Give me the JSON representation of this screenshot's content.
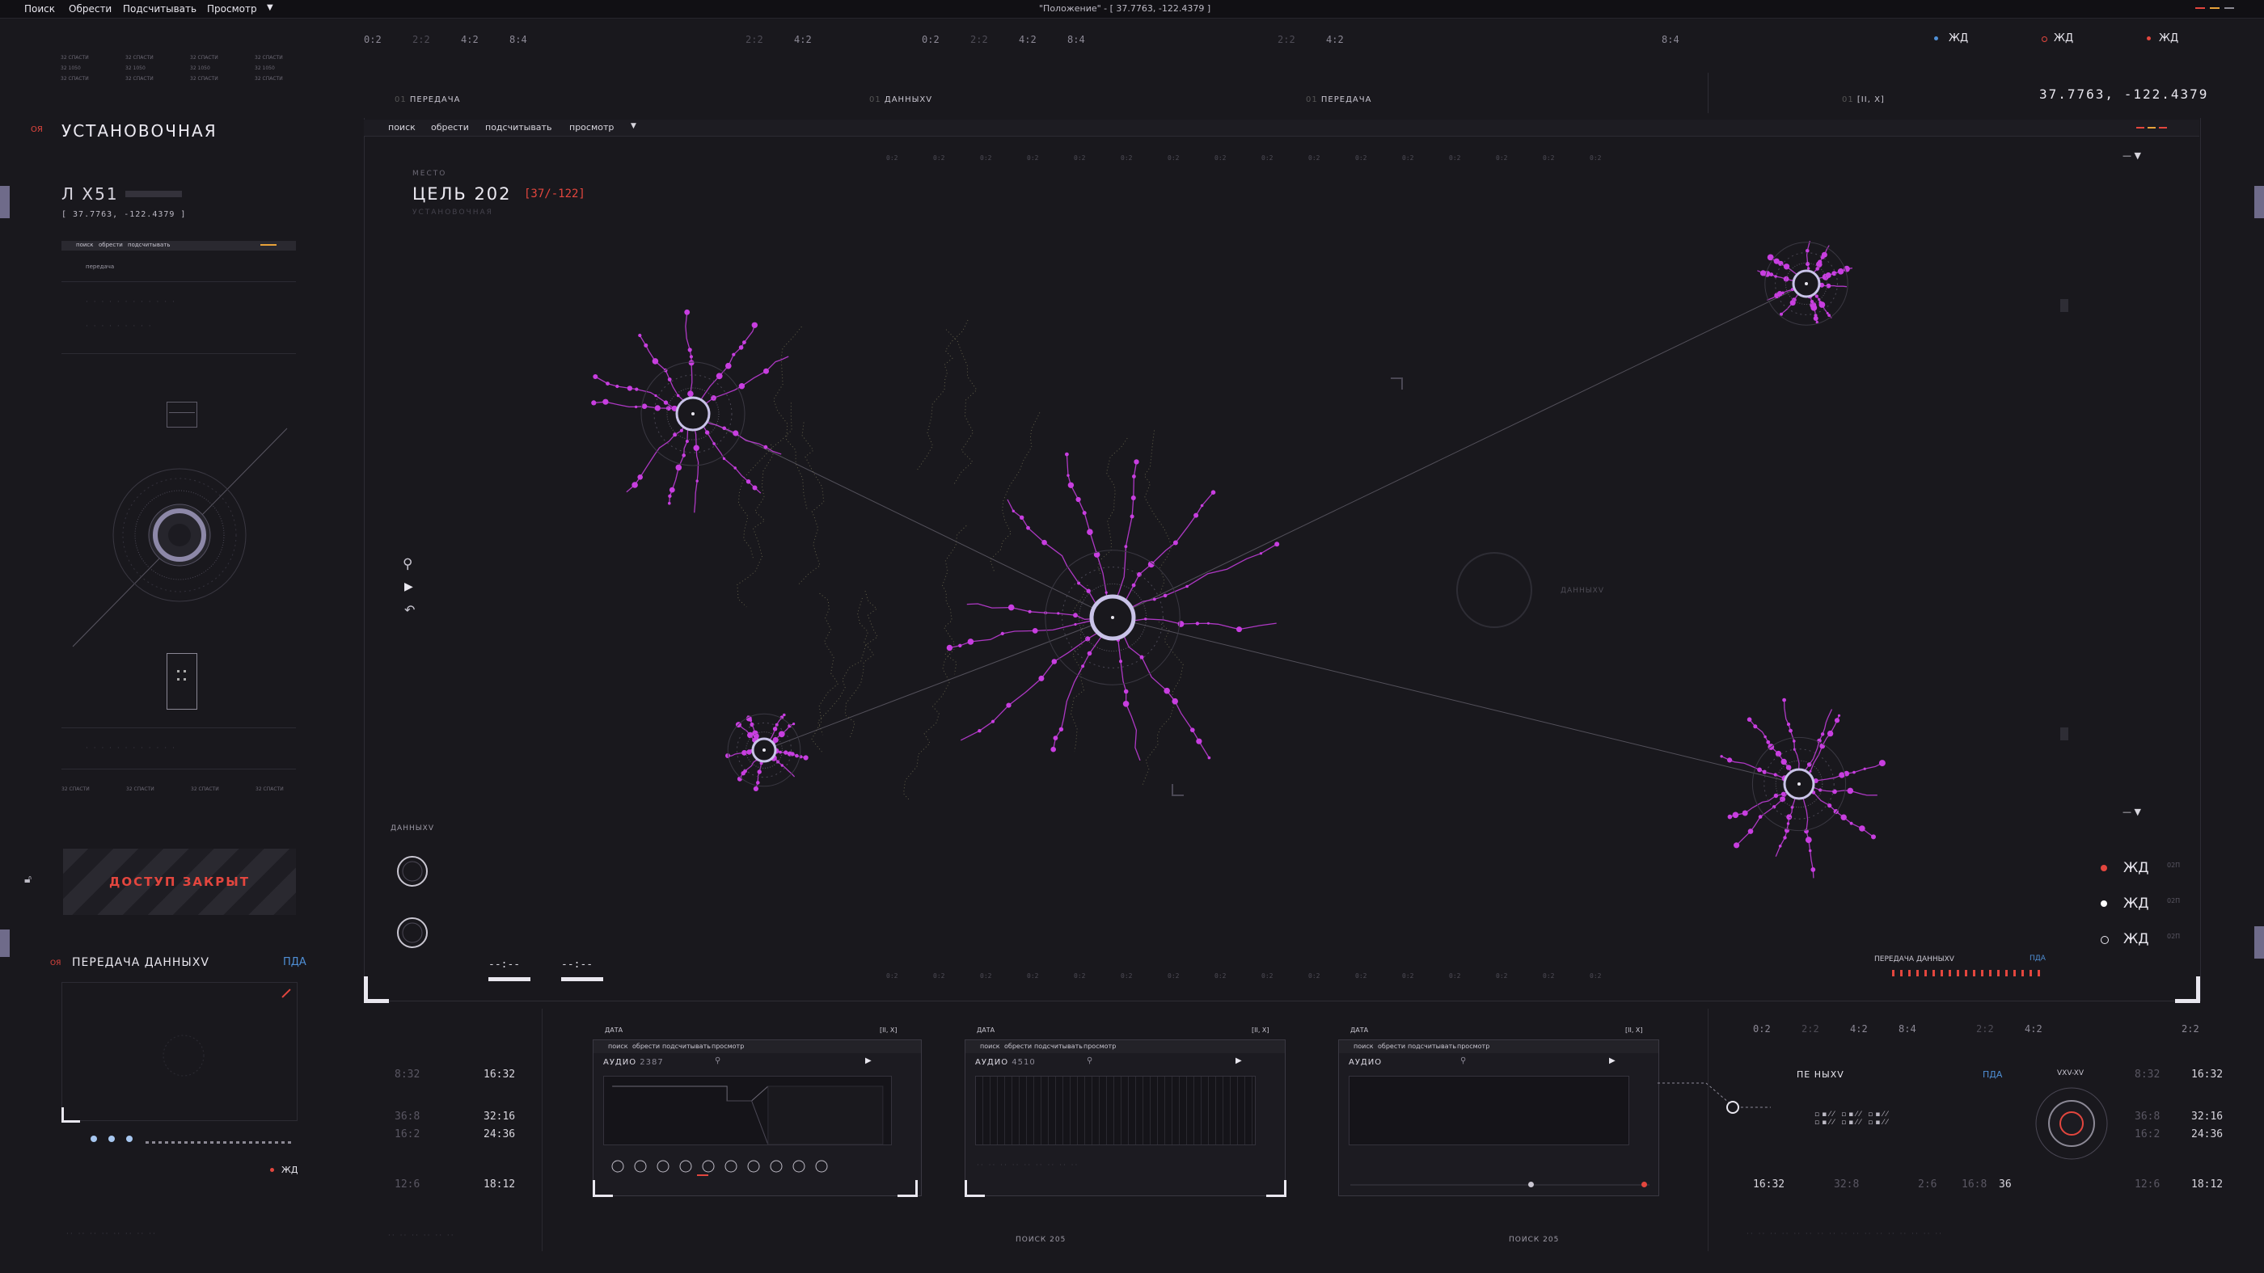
{
  "menu": {
    "items": [
      "Поиск",
      "Обрести",
      "Подсчитывать",
      "Просмотр"
    ],
    "window_title": "\"Положение\" - [ 37.7763, -122.4379 ]"
  },
  "top_ticks": [
    "0:2",
    "2:2",
    "4:2",
    "8:4",
    "2:2",
    "4:2",
    "0:2",
    "2:2",
    "4:2",
    "8:4",
    "2:2",
    "4:2",
    "8:4"
  ],
  "top_right": {
    "status": [
      "ЖД",
      "ЖД",
      "ЖД"
    ],
    "coords": "37.7763, -122.4379"
  },
  "section_labels": [
    "ПЕРЕДАЧА",
    "ДАННЫХV",
    "ПЕРЕДАЧА",
    "[II, X]"
  ],
  "left": {
    "mini_rows": [
      "32 СПАСТИ",
      "32 СПАСТИ",
      "32 СПАСТИ",
      "32 СПАСТИ",
      "32 1050",
      "32 1050",
      "32 1050",
      "32 1050",
      "32 СПАСТИ",
      "32 СПАСТИ",
      "32 СПАСТИ",
      "32 СПАСТИ"
    ],
    "code": "ОЯ",
    "title": "УСТАНОВОЧНАЯ",
    "unit": "Л X51",
    "coords": "[ 37.7763, -122.4379 ]",
    "mini_menu": [
      "поиск",
      "обрести",
      "подсчитывать"
    ],
    "mini_tab": "передача",
    "bottom_rows": [
      "32 СПАСТИ",
      "32 СПАСТИ",
      "32 СПАСТИ",
      "32 СПАСТИ"
    ],
    "access": "ДОСТУП ЗАКРЫТ",
    "transfer_title": "ПЕРЕДАЧА ДАННЫХV",
    "transfer_code": "ОЯ",
    "transfer_tag": "ПДА",
    "bottom_status": "ЖД"
  },
  "map": {
    "menu": [
      "поиск",
      "обрести",
      "подсчитывать",
      "просмотр"
    ],
    "place_label": "МЕСТО",
    "target": "ЦЕЛЬ 202",
    "target_range": "[37/-122]",
    "target_sub": "УСТАНОВОЧНАЯ",
    "ghost_label": "ДАННЫХV",
    "data_label": "ДАННЫХV",
    "legend": [
      {
        "label": "ЖД",
        "code": "02П",
        "color": "#e3463e"
      },
      {
        "label": "ЖД",
        "code": "02П",
        "color": "#ffffff"
      },
      {
        "label": "ЖД",
        "code": "02П",
        "color": "#2a2830"
      }
    ],
    "transfer_label": "ПЕРЕДАЧА ДАННЫХV",
    "transfer_tag": "ПДА",
    "readouts": [
      "--:--",
      "--:--"
    ],
    "axis_ticks": [
      "0:2",
      "0:2",
      "0:2",
      "0:2",
      "0:2",
      "0:2",
      "0:2",
      "0:2",
      "0:2",
      "0:2",
      "0:2",
      "0:2",
      "0:2",
      "0:2",
      "0:2",
      "0:2",
      "0:2"
    ]
  },
  "bottom": {
    "left_times": [
      [
        "8:32",
        "16:32"
      ],
      [
        "36:8",
        "32:16"
      ],
      [
        "16:2",
        "24:36"
      ],
      [
        "12:6",
        "18:12"
      ]
    ],
    "audio": [
      {
        "title": "АУДИО",
        "id": "2387",
        "label": "ДАТА",
        "code": "[II, X]",
        "menu": [
          "поиск",
          "обрести",
          "подсчитывать",
          "просмотр"
        ]
      },
      {
        "title": "АУДИО",
        "id": "4510",
        "label": "ДАТА",
        "code": "[II, X]",
        "menu": [
          "поиск",
          "обрести",
          "подсчитывать",
          "просмотр"
        ]
      },
      {
        "title": "АУДИО",
        "id": "",
        "label": "ДАТА",
        "code": "[II, X]",
        "menu": [
          "поиск",
          "обрести",
          "подсчитывать",
          "просмотр"
        ]
      }
    ],
    "search_labels": [
      "ПОИСК 205",
      "ПОИСК 205"
    ],
    "right_ticks": [
      "0:2",
      "2:2",
      "4:2",
      "8:4",
      "2:2",
      "4:2",
      "2:2"
    ],
    "right_title": "ПЕ НЫХV",
    "right_tag": "ПДА",
    "dial_label": "VXV-XV",
    "right_times": [
      [
        "8:32",
        "16:32"
      ],
      [
        "36:8",
        "32:16"
      ],
      [
        "16:2",
        "24:36"
      ],
      [
        "12:6",
        "18:12"
      ]
    ],
    "bottom_times": [
      "16:32",
      "32:8",
      "2:6",
      "16:8",
      "36"
    ]
  },
  "colors": {
    "bg": "#19181d",
    "accent": "#c83ee0",
    "red": "#e3463e",
    "blue": "#4f8fd6",
    "ring": "#c9c3e8"
  }
}
